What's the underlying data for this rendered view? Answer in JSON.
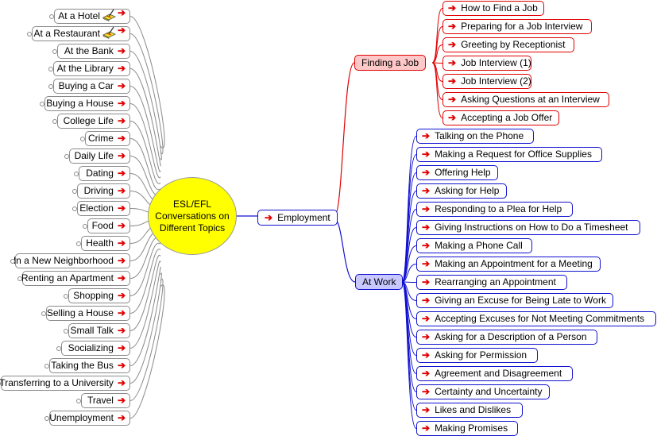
{
  "root": {
    "label": "ESL/EFL Conversations on Different Topics",
    "lines": [
      "ESL/EFL",
      "Conversations on",
      "Different Topics"
    ]
  },
  "colors": {
    "root_fill": "#ffff00",
    "finding_job": "#ffc8c8",
    "at_work": "#c8c8ff",
    "red": "#e00000",
    "blue": "#1010d0",
    "gray": "#8a8a8a"
  },
  "left_topics": [
    {
      "label": "At a Hotel",
      "icon": "edit-note-icon"
    },
    {
      "label": "At a Restaurant",
      "icon": "edit-note-icon"
    },
    {
      "label": "At the Bank",
      "icon": "arrow-link-icon"
    },
    {
      "label": "At the Library",
      "icon": "arrow-link-icon"
    },
    {
      "label": "Buying a Car",
      "icon": "arrow-link-icon"
    },
    {
      "label": "Buying a House",
      "icon": "arrow-link-icon"
    },
    {
      "label": "College Life",
      "icon": "arrow-link-icon"
    },
    {
      "label": "Crime",
      "icon": "arrow-link-icon"
    },
    {
      "label": "Daily Life",
      "icon": "arrow-link-icon"
    },
    {
      "label": "Dating",
      "icon": "arrow-link-icon"
    },
    {
      "label": "Driving",
      "icon": "arrow-link-icon"
    },
    {
      "label": "Election",
      "icon": "arrow-link-icon"
    },
    {
      "label": "Food",
      "icon": "arrow-link-icon"
    },
    {
      "label": "Health",
      "icon": "arrow-link-icon"
    },
    {
      "label": "In a New Neighborhood",
      "icon": "arrow-link-icon"
    },
    {
      "label": "Renting an Apartment",
      "icon": "arrow-link-icon"
    },
    {
      "label": "Shopping",
      "icon": "arrow-link-icon"
    },
    {
      "label": "Selling a House",
      "icon": "arrow-link-icon"
    },
    {
      "label": "Small Talk",
      "icon": "arrow-link-icon"
    },
    {
      "label": "Socializing",
      "icon": "arrow-link-icon"
    },
    {
      "label": "Taking the Bus",
      "icon": "arrow-link-icon"
    },
    {
      "label": "Transferring to a University",
      "icon": "arrow-link-icon"
    },
    {
      "label": "Travel",
      "icon": "arrow-link-icon"
    },
    {
      "label": "Unemployment",
      "icon": "arrow-link-icon"
    }
  ],
  "employment": {
    "label": "Employment",
    "arrow": "➔"
  },
  "finding_job": {
    "label": "Finding a Job",
    "items": [
      "How to Find a Job",
      "Preparing for a Job Interview",
      "Greeting by Receptionist",
      "Job Interview (1)",
      "Job Interview (2)",
      "Asking Questions at an Interview",
      "Accepting a Job Offer"
    ]
  },
  "at_work": {
    "label": "At Work",
    "items": [
      "Talking on the Phone",
      "Making a Request for Office Supplies",
      "Offering Help",
      "Asking for Help",
      "Responding to a Plea for Help",
      "Giving Instructions on How to Do a Timesheet",
      "Making a Phone Call",
      "Making an Appointment for a Meeting",
      "Rearranging an Appointment",
      "Giving an Excuse for Being Late to Work",
      "Accepting Excuses for Not Meeting Commitments",
      "Asking for a Description of a Person",
      "Asking for Permission",
      "Agreement and Disagreement",
      "Certainty and Uncertainty",
      "Likes and Dislikes",
      "Making Promises"
    ]
  },
  "arrow_glyph": "➔"
}
